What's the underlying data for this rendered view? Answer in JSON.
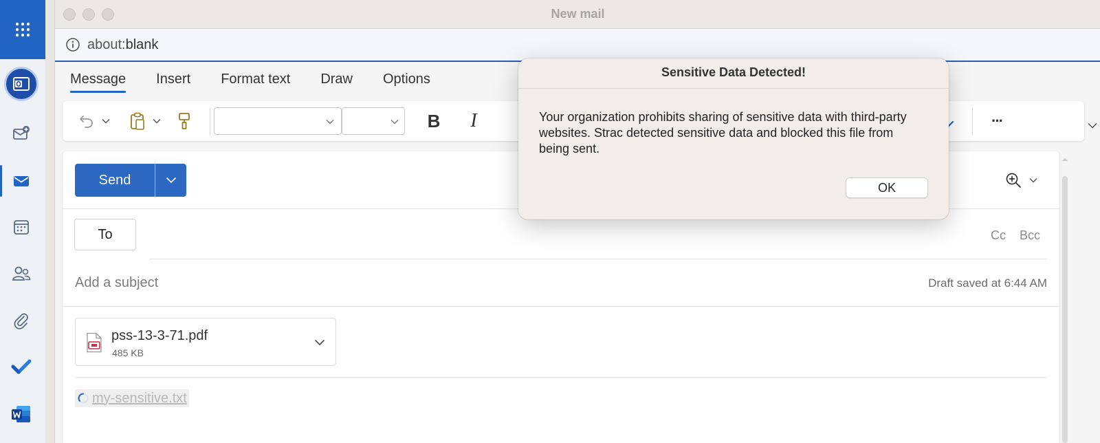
{
  "window": {
    "title": "New mail",
    "url_prefix": "about:",
    "url_path": "blank"
  },
  "tabs": [
    {
      "label": "Message",
      "active": true
    },
    {
      "label": "Insert",
      "active": false
    },
    {
      "label": "Format text",
      "active": false
    },
    {
      "label": "Draw",
      "active": false
    },
    {
      "label": "Options",
      "active": false
    }
  ],
  "rail": {
    "items": [
      "apps-grid-icon",
      "outlook-icon",
      "new-mail-icon",
      "mail-icon",
      "calendar-icon",
      "people-icon",
      "attachment-icon",
      "todo-icon",
      "word-icon"
    ],
    "selected": "mail-icon"
  },
  "toolbar": {
    "font_name": "",
    "font_size": "",
    "bold_label": "B",
    "italic_label": "I",
    "more_label": "···"
  },
  "compose": {
    "send_label": "Send",
    "to_label": "To",
    "cc_label": "Cc",
    "bcc_label": "Bcc",
    "subject_placeholder": "Add a subject",
    "draft_status": "Draft saved at 6:44 AM",
    "attachment": {
      "name": "pss-13-3-71.pdf",
      "size": "485 KB"
    },
    "uploading_file": "my-sensitive.txt"
  },
  "dialog": {
    "title": "Sensitive Data Detected!",
    "message": "Your organization prohibits sharing of sensitive data with third-party websites. Strac detected sensitive data and blocked this file from being sent.",
    "ok_label": "OK"
  },
  "colors": {
    "accent": "#2164c3",
    "send": "#2b69c3",
    "dialog_bg": "#f3ede9"
  }
}
